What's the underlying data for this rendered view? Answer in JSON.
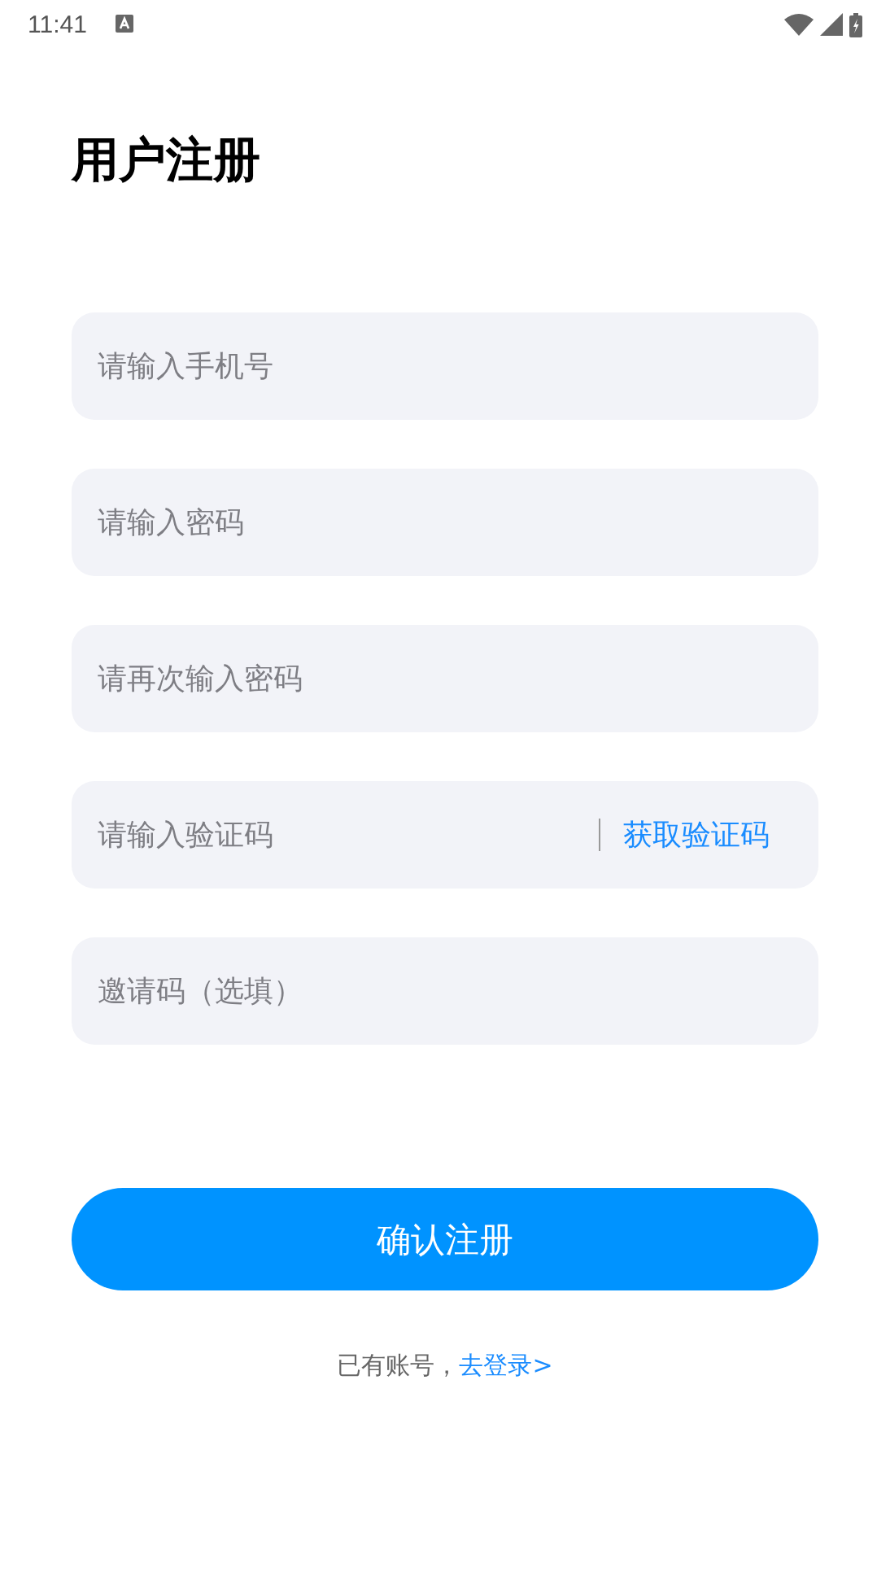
{
  "status_bar": {
    "time": "11:41"
  },
  "title": "用户注册",
  "fields": [
    {
      "kind": "input",
      "placeholder": "请输入手机号"
    },
    {
      "kind": "input",
      "placeholder": "请输入密码"
    },
    {
      "kind": "input",
      "placeholder": "请再次输入密码"
    },
    {
      "kind": "code",
      "placeholder": "请输入验证码",
      "action": "获取验证码"
    },
    {
      "kind": "input",
      "placeholder": "邀请码（选填）"
    }
  ],
  "submit": "确认注册",
  "footer": {
    "text": "已有账号，",
    "link": "去登录>"
  }
}
